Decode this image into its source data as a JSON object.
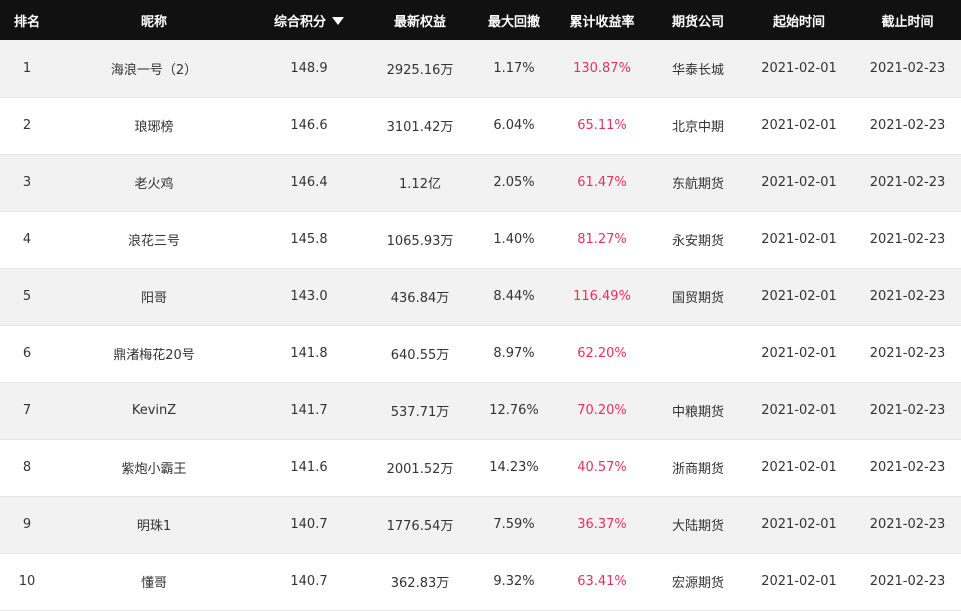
{
  "table": {
    "headers": {
      "rank": "排名",
      "nickname": "昵称",
      "score": "综合积分",
      "equity": "最新权益",
      "drawdown": "最大回撤",
      "return": "累计收益率",
      "company": "期货公司",
      "start": "起始时间",
      "end": "截止时间"
    },
    "sort": {
      "column": "综合积分",
      "direction": "descending"
    },
    "colors": {
      "header_bg": "#111111",
      "return_rate": "#e8305c",
      "stripe": "#f2f2f2"
    },
    "rows": [
      {
        "rank": "1",
        "nickname": "海浪一号（2）",
        "score": "148.9",
        "equity": "2925.16万",
        "drawdown": "1.17%",
        "return": "130.87%",
        "company": "华泰长城",
        "start": "2021-02-01",
        "end": "2021-02-23"
      },
      {
        "rank": "2",
        "nickname": "琅琊榜",
        "score": "146.6",
        "equity": "3101.42万",
        "drawdown": "6.04%",
        "return": "65.11%",
        "company": "北京中期",
        "start": "2021-02-01",
        "end": "2021-02-23"
      },
      {
        "rank": "3",
        "nickname": "老火鸡",
        "score": "146.4",
        "equity": "1.12亿",
        "drawdown": "2.05%",
        "return": "61.47%",
        "company": "东航期货",
        "start": "2021-02-01",
        "end": "2021-02-23"
      },
      {
        "rank": "4",
        "nickname": "浪花三号",
        "score": "145.8",
        "equity": "1065.93万",
        "drawdown": "1.40%",
        "return": "81.27%",
        "company": "永安期货",
        "start": "2021-02-01",
        "end": "2021-02-23"
      },
      {
        "rank": "5",
        "nickname": "阳哥",
        "score": "143.0",
        "equity": "436.84万",
        "drawdown": "8.44%",
        "return": "116.49%",
        "company": "国贸期货",
        "start": "2021-02-01",
        "end": "2021-02-23"
      },
      {
        "rank": "6",
        "nickname": "鼎渚梅花20号",
        "score": "141.8",
        "equity": "640.55万",
        "drawdown": "8.97%",
        "return": "62.20%",
        "company": "",
        "start": "2021-02-01",
        "end": "2021-02-23"
      },
      {
        "rank": "7",
        "nickname": "KevinZ",
        "score": "141.7",
        "equity": "537.71万",
        "drawdown": "12.76%",
        "return": "70.20%",
        "company": "中粮期货",
        "start": "2021-02-01",
        "end": "2021-02-23"
      },
      {
        "rank": "8",
        "nickname": "紫炮小霸王",
        "score": "141.6",
        "equity": "2001.52万",
        "drawdown": "14.23%",
        "return": "40.57%",
        "company": "浙商期货",
        "start": "2021-02-01",
        "end": "2021-02-23"
      },
      {
        "rank": "9",
        "nickname": "明珠1",
        "score": "140.7",
        "equity": "1776.54万",
        "drawdown": "7.59%",
        "return": "36.37%",
        "company": "大陆期货",
        "start": "2021-02-01",
        "end": "2021-02-23"
      },
      {
        "rank": "10",
        "nickname": "懂哥",
        "score": "140.7",
        "equity": "362.83万",
        "drawdown": "9.32%",
        "return": "63.41%",
        "company": "宏源期货",
        "start": "2021-02-01",
        "end": "2021-02-23"
      }
    ]
  }
}
